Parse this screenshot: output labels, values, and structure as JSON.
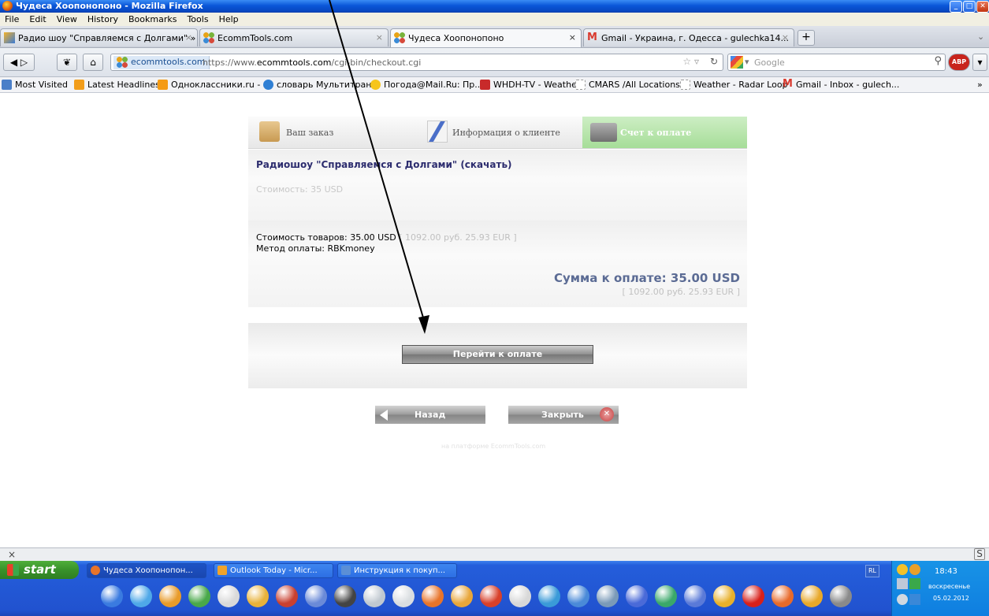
{
  "window": {
    "title": "Чудеса Хоопонопоно - Mozilla Firefox",
    "controls": [
      "minimize",
      "maximize",
      "close"
    ]
  },
  "menu": [
    "File",
    "Edit",
    "View",
    "History",
    "Bookmarks",
    "Tools",
    "Help"
  ],
  "tabs": [
    {
      "title": "Радио шоу \"Справляемся с Долгами\" » ...",
      "close": "×"
    },
    {
      "title": "EcommTools.com",
      "close": "×"
    },
    {
      "title": "Чудеса Хоопонопоно",
      "close": "×"
    },
    {
      "title": "Gmail - Украина, г. Одесса - gulechka14...",
      "close": "×"
    }
  ],
  "newtab_label": "+",
  "nav": {
    "site_label": "ecommtools.com",
    "url_prefix": "https://www.",
    "url_host": "ecommtools.com",
    "url_path": "/cgi-bin/checkout.cgi",
    "search_placeholder": "Google"
  },
  "bookmarks": [
    {
      "label": "Most Visited",
      "color": "#4a7fc8"
    },
    {
      "label": "Latest Headlines",
      "color": "#f29d1a"
    },
    {
      "label": "Одноклассники.ru - ...",
      "color": "#f59b14"
    },
    {
      "label": "словарь Мультитран",
      "color": "#2f7fd4"
    },
    {
      "label": "Погода@Mail.Ru: Пр...",
      "color": "#f6c51c"
    },
    {
      "label": "WHDH-TV - Weather",
      "color": "#c82a2a"
    },
    {
      "label": "CMARS /All Locations",
      "color": "#ffffff"
    },
    {
      "label": "Weather - Radar Loop",
      "color": "#ffffff"
    },
    {
      "label": "Gmail - Inbox - gulech...",
      "color": "#d93a2f"
    }
  ],
  "bookmarks_more": "»",
  "checkout": {
    "steps": [
      "Ваш заказ",
      "Информация о клиенте",
      "Счет к оплате"
    ],
    "active_step": 2,
    "product_title": "Радиошоу \"Справляемся с Долгами\" (скачать)",
    "product_price": "Стоимость: 35 USD",
    "goods_total": "Стоимость товаров: 35.00 USD",
    "goods_total_alt": "[ 1092.00 руб. 25.93 EUR ]",
    "payment_method": "Метод оплаты: RBKmoney",
    "sum_due": "Сумма к оплате: 35.00 USD",
    "sum_due_alt": "[ 1092.00 руб. 25.93 EUR ]",
    "pay_button": "Перейти к оплате",
    "back_button": "Назад",
    "close_button": "Закрыть",
    "footer": "на платформе EcommTools.com"
  },
  "findbar": {
    "close": "×",
    "right_icon": "S"
  },
  "taskbar": {
    "start": "start",
    "tasks": [
      {
        "label": "Чудеса Хоопонопон...",
        "color": "#e8742a"
      },
      {
        "label": "Outlook Today - Micr...",
        "color": "#f0a32a"
      },
      {
        "label": "Инструкция к покуп...",
        "color": "#5b8fd6"
      }
    ],
    "lang": "RL",
    "clock": "18:43",
    "day": "воскресенье",
    "date": "05.02.2012",
    "quicklaunch_colors": [
      "#3a7be0",
      "#4fa8e8",
      "#e89b2a",
      "#49a84a",
      "#d9d9d9",
      "#e8b23a",
      "#c94030",
      "#6a8ad8",
      "#444444",
      "#c0c8d0",
      "#d9dde0",
      "#e8742a",
      "#e8a63a",
      "#d8402a",
      "#d8d8d8",
      "#3a9ad8",
      "#4a8ad8",
      "#7a9ab8",
      "#4a6ad8",
      "#3aa86a",
      "#5a7ad8",
      "#e8b02a",
      "#d8201a",
      "#e86a2a",
      "#e8a82a",
      "#8a8a8a"
    ]
  }
}
